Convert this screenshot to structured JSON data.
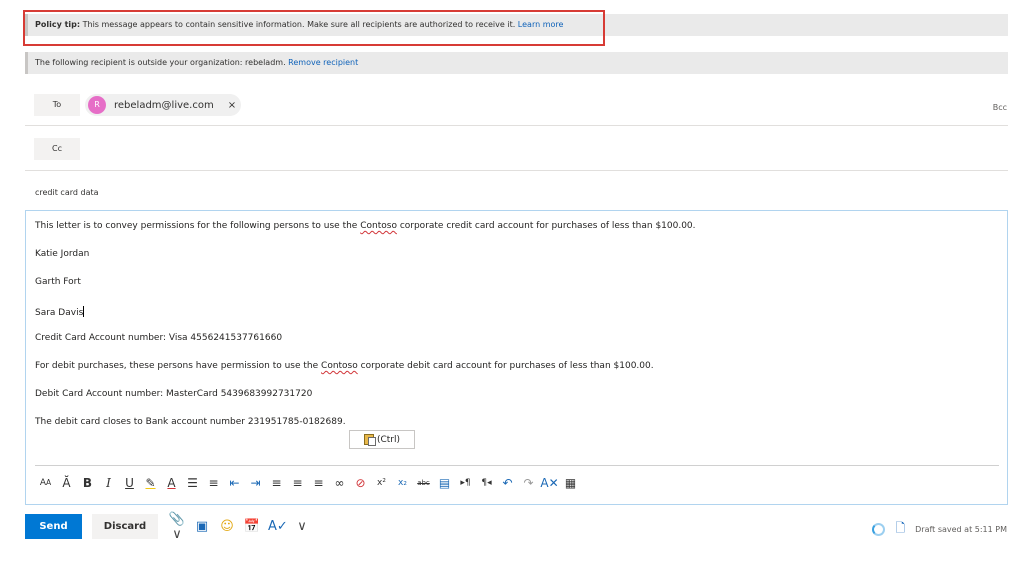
{
  "banners": {
    "policy_label": "Policy tip:",
    "policy_text": " This message appears to contain sensitive information. Make sure all recipients are authorized to receive it.  ",
    "policy_link": "Learn more",
    "external_text": "The following recipient is outside your organization: rebeladm. ",
    "external_link": "Remove recipient"
  },
  "recipients": {
    "to_label": "To",
    "cc_label": "Cc",
    "bcc_label": "Bcc",
    "to_chip": {
      "initial": "R",
      "email": "rebeladm@live.com",
      "remove": "×"
    }
  },
  "subject": "credit card data",
  "body": {
    "line1_pre": "This letter is to convey permissions for the following persons to use the ",
    "brand": "Contoso",
    "line1_post": " corporate credit card account for purchases of less than $100.00.",
    "name1": "Katie Jordan",
    "name2": "Garth Fort",
    "name3": "Sara Davis",
    "credit": "Credit Card Account number: Visa 4556241537761660",
    "line2_pre": "For debit purchases, these persons have permission to use the ",
    "line2_post": " corporate debit card account for purchases of less than $100.00.",
    "debit": "Debit Card Account number: MasterCard 5439683992731720",
    "bank": "The debit card closes to Bank account number 231951785-0182689."
  },
  "paste_options": {
    "label": "(Ctrl)"
  },
  "toolbar_icons": [
    "font-size-icon",
    "font-grow-icon",
    "font-shrink-icon",
    "bold-icon",
    "italic-icon",
    "underline-icon",
    "highlight-icon",
    "font-color-icon",
    "bullets-icon",
    "numbering-icon",
    "decrease-indent-icon",
    "increase-indent-icon",
    "align-left-icon",
    "align-center-icon",
    "align-right-icon",
    "link-icon",
    "remove-link-icon",
    "superscript-icon",
    "subscript-icon",
    "strikethrough-icon",
    "insert-picture-icon",
    "ltr-icon",
    "rtl-icon",
    "undo-icon",
    "redo-icon",
    "clear-formatting-icon",
    "table-icon"
  ],
  "actions": {
    "send": "Send",
    "discard": "Discard",
    "draft_status": "Draft saved at 5:11 PM"
  },
  "colors": {
    "accent": "#0078d4",
    "avatar": "#e66ec7",
    "highlight_border": "#d73b35"
  }
}
